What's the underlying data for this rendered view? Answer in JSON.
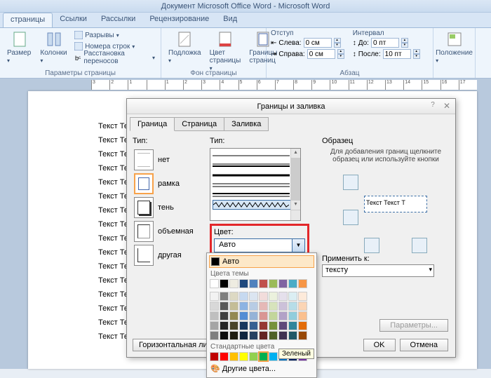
{
  "titlebar": "Документ Microsoft Office Word - Microsoft Word",
  "tabs": {
    "active": "страницы",
    "items": [
      "страницы",
      "Ссылки",
      "Рассылки",
      "Рецензирование",
      "Вид"
    ]
  },
  "ribbon": {
    "group_page": {
      "label": "Параметры страницы",
      "size": "Размер",
      "columns": "Колонки",
      "breaks": "Разрывы",
      "lines": "Номера строк",
      "hyphen": "Расстановка переносов"
    },
    "group_bg": {
      "label": "Фон страницы",
      "watermark": "Подложка",
      "color": "Цвет страницы",
      "borders": "Границы страниц"
    },
    "group_para": {
      "label": "Абзац",
      "indent_title": "Отступ",
      "spacing_title": "Интервал",
      "left": "Слева:",
      "right": "Справа:",
      "before": "До:",
      "after": "После:",
      "left_val": "0 см",
      "right_val": "0 см",
      "before_val": "0 пт",
      "after_val": "10 пт"
    },
    "group_arrange": {
      "position": "Положение"
    }
  },
  "doc_line": "Текст Текст Текст Текст Текст Текст Текст Текст",
  "dialog": {
    "title": "Границы и заливка",
    "tabs": {
      "border": "Граница",
      "page": "Страница",
      "fill": "Заливка"
    },
    "type_label": "Тип:",
    "options": {
      "none": "нет",
      "box": "рамка",
      "shadow": "тень",
      "3d": "объемная",
      "custom": "другая"
    },
    "style_label": "Тип:",
    "color_label": "Цвет:",
    "color_value": "Авто",
    "preview_label": "Образец",
    "preview_hint": "Для добавления границ щелкните образец или используйте кнопки",
    "preview_sample": "Текст Текст Т",
    "apply_label": "Применить к:",
    "apply_value": "тексту",
    "params": "Параметры...",
    "hline": "Горизонтальная линия...",
    "ok": "OK",
    "cancel": "Отмена"
  },
  "color_popup": {
    "auto": "Авто",
    "theme": "Цвета темы",
    "standard": "Стандартные цвета",
    "other": "Другие цвета...",
    "tooltip": "Зеленый",
    "theme_row1": [
      "#ffffff",
      "#000000",
      "#eeece1",
      "#1f497d",
      "#4f81bd",
      "#c0504d",
      "#9bbb59",
      "#8064a2",
      "#4bacc6",
      "#f79646"
    ],
    "theme_shades": [
      [
        "#f2f2f2",
        "#7f7f7f",
        "#ddd9c3",
        "#c6d9f0",
        "#dbe5f1",
        "#f2dcdb",
        "#ebf1dd",
        "#e5e0ec",
        "#dbeef3",
        "#fdeada"
      ],
      [
        "#d8d8d8",
        "#595959",
        "#c4bd97",
        "#8db3e2",
        "#b8cce4",
        "#e5b9b7",
        "#d7e3bc",
        "#ccc1d9",
        "#b7dde8",
        "#fbd5b5"
      ],
      [
        "#bfbfbf",
        "#3f3f3f",
        "#938953",
        "#548dd4",
        "#95b3d7",
        "#d99694",
        "#c3d69b",
        "#b2a2c7",
        "#92cddc",
        "#fac08f"
      ],
      [
        "#a5a5a5",
        "#262626",
        "#494429",
        "#17365d",
        "#366092",
        "#953734",
        "#76923c",
        "#5f497a",
        "#31859b",
        "#e36c09"
      ],
      [
        "#7f7f7f",
        "#0c0c0c",
        "#1d1b10",
        "#0f243e",
        "#244061",
        "#632423",
        "#4f6128",
        "#3f3151",
        "#205867",
        "#974806"
      ]
    ],
    "standard_colors": [
      "#c00000",
      "#ff0000",
      "#ffc000",
      "#ffff00",
      "#92d050",
      "#00b050",
      "#00b0f0",
      "#0070c0",
      "#002060",
      "#7030a0"
    ]
  },
  "ruler_numbers": [
    "3",
    "2",
    "1",
    "",
    "1",
    "2",
    "3",
    "4",
    "5",
    "6",
    "7",
    "8",
    "9",
    "10",
    "11",
    "12",
    "13",
    "14",
    "15",
    "16",
    "17"
  ]
}
